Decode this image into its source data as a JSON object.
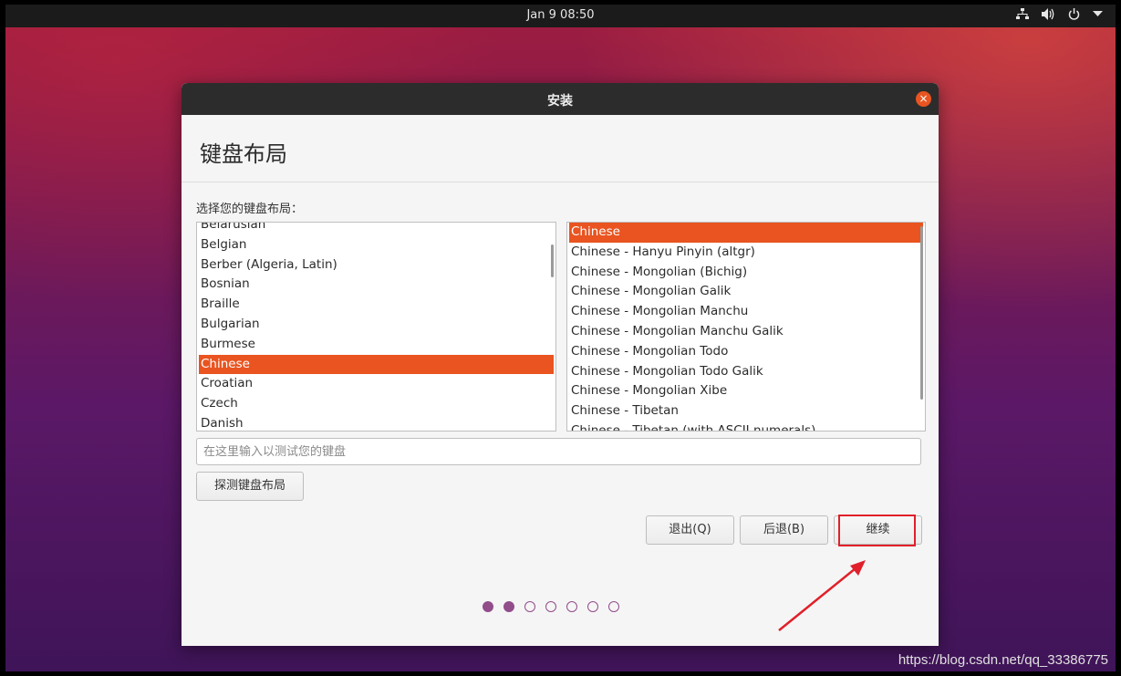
{
  "topbar": {
    "clock": "Jan 9  08:50",
    "icons": [
      "network-icon",
      "volume-icon",
      "power-icon",
      "menu-arrow-icon"
    ]
  },
  "window": {
    "title": "安装",
    "close_label": "×"
  },
  "page": {
    "heading": "键盘布局",
    "prompt": "选择您的键盘布局："
  },
  "layouts": {
    "items": [
      "Belarusian",
      "Belgian",
      "Berber (Algeria, Latin)",
      "Bosnian",
      "Braille",
      "Bulgarian",
      "Burmese",
      "Chinese",
      "Croatian",
      "Czech",
      "Danish"
    ],
    "selected": "Chinese"
  },
  "variants": {
    "items": [
      "Chinese",
      "Chinese - Hanyu Pinyin (altgr)",
      "Chinese - Mongolian (Bichig)",
      "Chinese - Mongolian Galik",
      "Chinese - Mongolian Manchu",
      "Chinese - Mongolian Manchu Galik",
      "Chinese - Mongolian Todo",
      "Chinese - Mongolian Todo Galik",
      "Chinese - Mongolian Xibe",
      "Chinese - Tibetan",
      "Chinese - Tibetan (with ASCII numerals)"
    ],
    "selected": "Chinese"
  },
  "test_input": {
    "value": "",
    "placeholder": "在这里输入以测试您的键盘"
  },
  "buttons": {
    "detect": "探测键盘布局",
    "quit": "退出(Q)",
    "back": "后退(B)",
    "continue": "继续"
  },
  "progress": {
    "total_steps": 7,
    "completed_steps": 2
  },
  "colors": {
    "accent": "#e95420",
    "progress": "#924d8b",
    "annotation": "#e0202a"
  },
  "watermark": "https://blog.csdn.net/qq_33386775"
}
